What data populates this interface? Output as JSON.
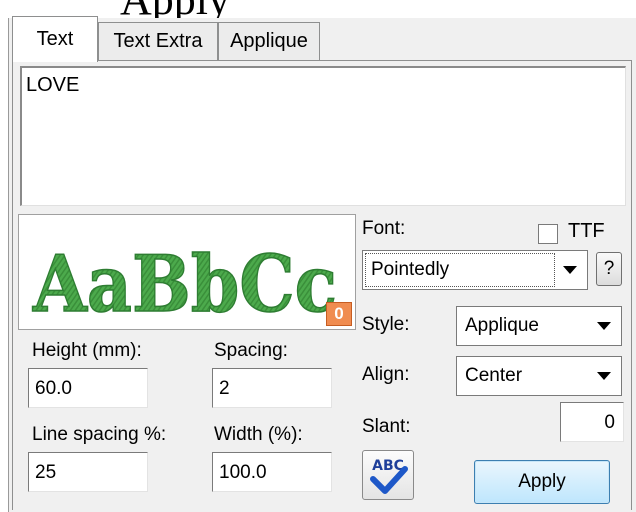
{
  "heading_partial": "Apply",
  "tabs": [
    {
      "label": "Text",
      "active": true
    },
    {
      "label": "Text Extra",
      "active": false
    },
    {
      "label": "Applique",
      "active": false
    }
  ],
  "text_input": {
    "value": "LOVE"
  },
  "preview": {
    "sample_text": "AaBbCc",
    "badge": "0"
  },
  "font": {
    "label": "Font:",
    "value": "Pointedly",
    "ttf_label": "TTF",
    "ttf_checked": false,
    "help": "?"
  },
  "style": {
    "label": "Style:",
    "value": "Applique"
  },
  "align": {
    "label": "Align:",
    "value": "Center"
  },
  "slant": {
    "label": "Slant:",
    "value": "0"
  },
  "height": {
    "label": "Height (mm):",
    "value": "60.0"
  },
  "spacing": {
    "label": "Spacing:",
    "value": "2"
  },
  "line_spacing": {
    "label": "Line spacing %:",
    "value": "25"
  },
  "width": {
    "label": "Width (%):",
    "value": "100.0"
  },
  "spellcheck": {
    "icon_text": "ABC"
  },
  "apply_label": "Apply",
  "colors": {
    "stitch_green": "#4caa4c",
    "stitch_dark": "#2e7d32",
    "apply_blue": "#bee6fd",
    "badge_orange": "#f08c50"
  }
}
